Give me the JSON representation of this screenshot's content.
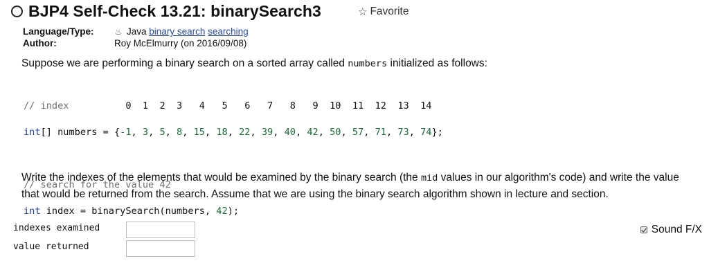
{
  "header": {
    "title": "BJP4 Self-Check 13.21: binarySearch3",
    "favorite_label": "Favorite"
  },
  "meta": {
    "language_key": "Language/Type:",
    "language_value": "Java",
    "tags": [
      "binary search",
      "searching"
    ],
    "author_key": "Author:",
    "author_value": "Roy McElmurry (on 2016/09/08)"
  },
  "intro": {
    "text_before": "Suppose we are performing a binary search on a sorted array called ",
    "code_word": "numbers",
    "text_after": " initialized as follows:"
  },
  "code": {
    "line1_comment": "// index",
    "indexes": [
      "0",
      "1",
      "2",
      "3",
      "4",
      "5",
      "6",
      "7",
      "8",
      "9",
      "10",
      "11",
      "12",
      "13",
      "14"
    ],
    "line2_decl": "int[] numbers = {",
    "values": [
      "-1",
      "3",
      "5",
      "8",
      "15",
      "18",
      "22",
      "39",
      "40",
      "42",
      "50",
      "57",
      "71",
      "73",
      "74"
    ],
    "line2_end": "};",
    "line3_comment": "// search for the value 42",
    "line4_type": "int",
    "line4_rest": " index = binarySearch(numbers, ",
    "line4_arg": "42",
    "line4_end": ");"
  },
  "instructions": {
    "text_before": "Write the indexes of the elements that would be examined by the binary search (the ",
    "code_word": "mid",
    "text_after": " values in our algorithm's code) and write the value that would be returned from the search. Assume that we are using the binary search algorithm shown in lecture and section."
  },
  "answers": {
    "indexes_label": "indexes examined",
    "indexes_value": "",
    "value_label": "value returned",
    "value_value": ""
  },
  "sound": {
    "label": "Sound F/X",
    "checked": true
  }
}
